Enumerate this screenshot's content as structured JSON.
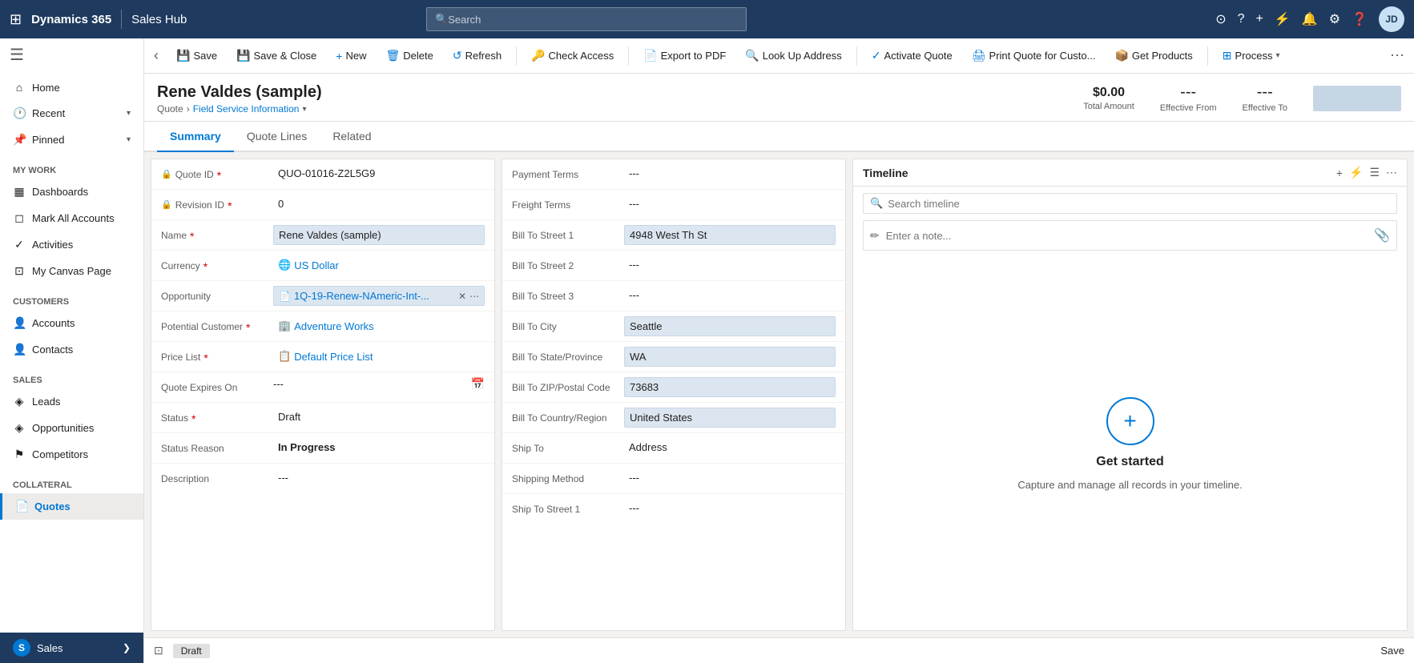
{
  "topNav": {
    "appName": "Dynamics 365",
    "moduleName": "Sales Hub",
    "searchPlaceholder": "Search",
    "avatarText": "JD"
  },
  "sidebar": {
    "sections": [
      {
        "items": [
          {
            "id": "home",
            "label": "Home",
            "icon": "⌂"
          },
          {
            "id": "recent",
            "label": "Recent",
            "icon": "🕐",
            "hasChevron": true
          },
          {
            "id": "pinned",
            "label": "Pinned",
            "icon": "📌",
            "hasChevron": true
          }
        ]
      },
      {
        "title": "My Work",
        "items": [
          {
            "id": "dashboards",
            "label": "Dashboards",
            "icon": "▦"
          },
          {
            "id": "mark-all-accounts",
            "label": "Mark All Accounts",
            "icon": ""
          },
          {
            "id": "activities",
            "label": "Activities",
            "icon": "✓"
          },
          {
            "id": "my-canvas-page",
            "label": "My Canvas Page",
            "icon": "⊡"
          }
        ]
      },
      {
        "title": "Customers",
        "items": [
          {
            "id": "accounts",
            "label": "Accounts",
            "icon": "👤"
          },
          {
            "id": "contacts",
            "label": "Contacts",
            "icon": "👤"
          }
        ]
      },
      {
        "title": "Sales",
        "items": [
          {
            "id": "leads",
            "label": "Leads",
            "icon": "◈"
          },
          {
            "id": "opportunities",
            "label": "Opportunities",
            "icon": "◈"
          },
          {
            "id": "competitors",
            "label": "Competitors",
            "icon": "⚑"
          }
        ]
      },
      {
        "title": "Collateral",
        "items": [
          {
            "id": "quotes",
            "label": "Quotes",
            "icon": "📄",
            "active": true
          }
        ]
      }
    ],
    "bottomItem": {
      "id": "sales",
      "label": "Sales",
      "icon": "S"
    }
  },
  "toolbar": {
    "backLabel": "‹",
    "buttons": [
      {
        "id": "save",
        "icon": "💾",
        "label": "Save"
      },
      {
        "id": "save-close",
        "icon": "💾",
        "label": "Save & Close"
      },
      {
        "id": "new",
        "icon": "+",
        "label": "New"
      },
      {
        "id": "delete",
        "icon": "🗑",
        "label": "Delete"
      },
      {
        "id": "refresh",
        "icon": "↺",
        "label": "Refresh"
      },
      {
        "id": "check-access",
        "icon": "🔑",
        "label": "Check Access"
      },
      {
        "id": "export-pdf",
        "icon": "📄",
        "label": "Export to PDF"
      },
      {
        "id": "lookup-address",
        "icon": "🔍",
        "label": "Look Up Address"
      },
      {
        "id": "activate-quote",
        "icon": "✓",
        "label": "Activate Quote"
      },
      {
        "id": "print-quote",
        "icon": "🖨",
        "label": "Print Quote for Custo..."
      },
      {
        "id": "get-products",
        "icon": "📦",
        "label": "Get Products"
      },
      {
        "id": "process",
        "icon": "⊞",
        "label": "Process"
      }
    ]
  },
  "record": {
    "title": "Rene Valdes (sample)",
    "breadcrumb1": "Quote",
    "breadcrumb2": "Field Service Information",
    "totalAmountLabel": "Total Amount",
    "totalAmountValue": "$0.00",
    "effectiveFromLabel": "Effective From",
    "effectiveFromValue": "---",
    "effectiveToLabel": "Effective To",
    "effectiveToValue": "---"
  },
  "tabs": [
    {
      "id": "summary",
      "label": "Summary",
      "active": true
    },
    {
      "id": "quote-lines",
      "label": "Quote Lines"
    },
    {
      "id": "related",
      "label": "Related"
    }
  ],
  "formLeft": {
    "fields": [
      {
        "id": "quote-id",
        "label": "Quote ID",
        "value": "QUO-01016-Z2L5G9",
        "required": true,
        "locked": true,
        "style": "normal"
      },
      {
        "id": "revision-id",
        "label": "Revision ID",
        "value": "0",
        "required": true,
        "locked": true,
        "style": "normal"
      },
      {
        "id": "name",
        "label": "Name",
        "value": "Rene Valdes (sample)",
        "required": true,
        "style": "filled"
      },
      {
        "id": "currency",
        "label": "Currency",
        "value": "US Dollar",
        "required": true,
        "style": "link",
        "icon": "🌐"
      },
      {
        "id": "opportunity",
        "label": "Opportunity",
        "value": "1Q-19-Renew-NAmeric-Int-...",
        "style": "opportunity"
      },
      {
        "id": "potential-customer",
        "label": "Potential Customer",
        "value": "Adventure Works",
        "required": true,
        "style": "link",
        "icon": "🏢"
      },
      {
        "id": "price-list",
        "label": "Price List",
        "value": "Default Price List",
        "required": true,
        "style": "link",
        "icon": "📋"
      },
      {
        "id": "quote-expires-on",
        "label": "Quote Expires On",
        "value": "---",
        "style": "date"
      },
      {
        "id": "status",
        "label": "Status",
        "value": "Draft",
        "required": true,
        "style": "normal"
      },
      {
        "id": "status-reason",
        "label": "Status Reason",
        "value": "In Progress",
        "style": "normal"
      },
      {
        "id": "description",
        "label": "Description",
        "value": "---",
        "style": "normal"
      }
    ]
  },
  "formMiddle": {
    "fields": [
      {
        "id": "payment-terms",
        "label": "Payment Terms",
        "value": "---"
      },
      {
        "id": "freight-terms",
        "label": "Freight Terms",
        "value": "---"
      },
      {
        "id": "bill-to-street-1",
        "label": "Bill To Street 1",
        "value": "4948 West Th St",
        "style": "filled"
      },
      {
        "id": "bill-to-street-2",
        "label": "Bill To Street 2",
        "value": "---"
      },
      {
        "id": "bill-to-street-3",
        "label": "Bill To Street 3",
        "value": "---"
      },
      {
        "id": "bill-to-city",
        "label": "Bill To City",
        "value": "Seattle",
        "style": "filled"
      },
      {
        "id": "bill-to-state",
        "label": "Bill To State/Province",
        "value": "WA",
        "style": "filled"
      },
      {
        "id": "bill-to-zip",
        "label": "Bill To ZIP/Postal Code",
        "value": "73683",
        "style": "filled"
      },
      {
        "id": "bill-to-country",
        "label": "Bill To Country/Region",
        "value": "United States",
        "style": "filled"
      },
      {
        "id": "ship-to",
        "label": "Ship To",
        "value": "Address"
      },
      {
        "id": "shipping-method",
        "label": "Shipping Method",
        "value": "---"
      },
      {
        "id": "ship-to-street-1",
        "label": "Ship To Street 1",
        "value": "---"
      }
    ]
  },
  "timeline": {
    "title": "Timeline",
    "searchPlaceholder": "Search timeline",
    "notePlaceholder": "Enter a note...",
    "emptyTitle": "Get started",
    "emptySubtitle": "Capture and manage all records in your timeline."
  },
  "statusBar": {
    "statusLabel": "Draft",
    "saveLabel": "Save"
  }
}
